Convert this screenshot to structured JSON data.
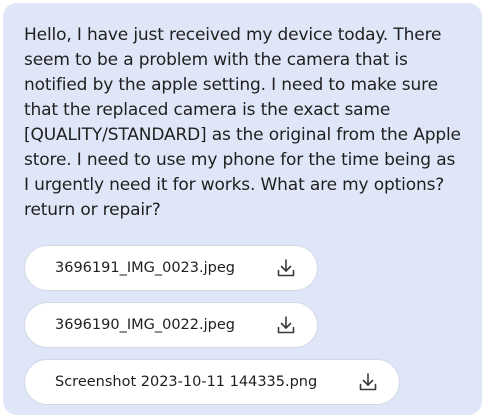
{
  "message": {
    "text": "Hello, I have just received my device today. There seem to be a problem with the camera that is notified by the apple setting. I need to make sure that the replaced camera is the exact same [QUALITY/STANDARD] as the original from the Apple store. I need to use my phone for the time being as I urgently need it for works. What are my options? return or repair?"
  },
  "attachments": [
    {
      "filename": "3696191_IMG_0023.jpeg",
      "icon": "download-icon"
    },
    {
      "filename": "3696190_IMG_0022.jpeg",
      "icon": "download-icon"
    },
    {
      "filename": "Screenshot 2023-10-11 144335.png",
      "icon": "download-icon"
    }
  ],
  "colors": {
    "bubble_background": "#dfe6f7",
    "chip_background": "#ffffff",
    "text": "#1f1f1f"
  }
}
